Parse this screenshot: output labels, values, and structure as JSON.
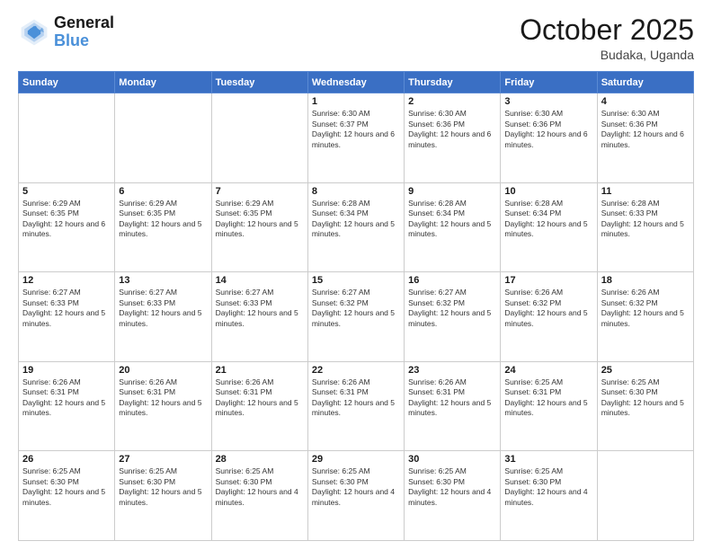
{
  "header": {
    "logo": {
      "line1": "General",
      "line2": "Blue"
    },
    "title": "October 2025",
    "subtitle": "Budaka, Uganda"
  },
  "weekdays": [
    "Sunday",
    "Monday",
    "Tuesday",
    "Wednesday",
    "Thursday",
    "Friday",
    "Saturday"
  ],
  "weeks": [
    [
      {
        "day": "",
        "info": ""
      },
      {
        "day": "",
        "info": ""
      },
      {
        "day": "",
        "info": ""
      },
      {
        "day": "1",
        "info": "Sunrise: 6:30 AM\nSunset: 6:37 PM\nDaylight: 12 hours and 6 minutes."
      },
      {
        "day": "2",
        "info": "Sunrise: 6:30 AM\nSunset: 6:36 PM\nDaylight: 12 hours and 6 minutes."
      },
      {
        "day": "3",
        "info": "Sunrise: 6:30 AM\nSunset: 6:36 PM\nDaylight: 12 hours and 6 minutes."
      },
      {
        "day": "4",
        "info": "Sunrise: 6:30 AM\nSunset: 6:36 PM\nDaylight: 12 hours and 6 minutes."
      }
    ],
    [
      {
        "day": "5",
        "info": "Sunrise: 6:29 AM\nSunset: 6:35 PM\nDaylight: 12 hours and 6 minutes."
      },
      {
        "day": "6",
        "info": "Sunrise: 6:29 AM\nSunset: 6:35 PM\nDaylight: 12 hours and 5 minutes."
      },
      {
        "day": "7",
        "info": "Sunrise: 6:29 AM\nSunset: 6:35 PM\nDaylight: 12 hours and 5 minutes."
      },
      {
        "day": "8",
        "info": "Sunrise: 6:28 AM\nSunset: 6:34 PM\nDaylight: 12 hours and 5 minutes."
      },
      {
        "day": "9",
        "info": "Sunrise: 6:28 AM\nSunset: 6:34 PM\nDaylight: 12 hours and 5 minutes."
      },
      {
        "day": "10",
        "info": "Sunrise: 6:28 AM\nSunset: 6:34 PM\nDaylight: 12 hours and 5 minutes."
      },
      {
        "day": "11",
        "info": "Sunrise: 6:28 AM\nSunset: 6:33 PM\nDaylight: 12 hours and 5 minutes."
      }
    ],
    [
      {
        "day": "12",
        "info": "Sunrise: 6:27 AM\nSunset: 6:33 PM\nDaylight: 12 hours and 5 minutes."
      },
      {
        "day": "13",
        "info": "Sunrise: 6:27 AM\nSunset: 6:33 PM\nDaylight: 12 hours and 5 minutes."
      },
      {
        "day": "14",
        "info": "Sunrise: 6:27 AM\nSunset: 6:33 PM\nDaylight: 12 hours and 5 minutes."
      },
      {
        "day": "15",
        "info": "Sunrise: 6:27 AM\nSunset: 6:32 PM\nDaylight: 12 hours and 5 minutes."
      },
      {
        "day": "16",
        "info": "Sunrise: 6:27 AM\nSunset: 6:32 PM\nDaylight: 12 hours and 5 minutes."
      },
      {
        "day": "17",
        "info": "Sunrise: 6:26 AM\nSunset: 6:32 PM\nDaylight: 12 hours and 5 minutes."
      },
      {
        "day": "18",
        "info": "Sunrise: 6:26 AM\nSunset: 6:32 PM\nDaylight: 12 hours and 5 minutes."
      }
    ],
    [
      {
        "day": "19",
        "info": "Sunrise: 6:26 AM\nSunset: 6:31 PM\nDaylight: 12 hours and 5 minutes."
      },
      {
        "day": "20",
        "info": "Sunrise: 6:26 AM\nSunset: 6:31 PM\nDaylight: 12 hours and 5 minutes."
      },
      {
        "day": "21",
        "info": "Sunrise: 6:26 AM\nSunset: 6:31 PM\nDaylight: 12 hours and 5 minutes."
      },
      {
        "day": "22",
        "info": "Sunrise: 6:26 AM\nSunset: 6:31 PM\nDaylight: 12 hours and 5 minutes."
      },
      {
        "day": "23",
        "info": "Sunrise: 6:26 AM\nSunset: 6:31 PM\nDaylight: 12 hours and 5 minutes."
      },
      {
        "day": "24",
        "info": "Sunrise: 6:25 AM\nSunset: 6:31 PM\nDaylight: 12 hours and 5 minutes."
      },
      {
        "day": "25",
        "info": "Sunrise: 6:25 AM\nSunset: 6:30 PM\nDaylight: 12 hours and 5 minutes."
      }
    ],
    [
      {
        "day": "26",
        "info": "Sunrise: 6:25 AM\nSunset: 6:30 PM\nDaylight: 12 hours and 5 minutes."
      },
      {
        "day": "27",
        "info": "Sunrise: 6:25 AM\nSunset: 6:30 PM\nDaylight: 12 hours and 5 minutes."
      },
      {
        "day": "28",
        "info": "Sunrise: 6:25 AM\nSunset: 6:30 PM\nDaylight: 12 hours and 4 minutes."
      },
      {
        "day": "29",
        "info": "Sunrise: 6:25 AM\nSunset: 6:30 PM\nDaylight: 12 hours and 4 minutes."
      },
      {
        "day": "30",
        "info": "Sunrise: 6:25 AM\nSunset: 6:30 PM\nDaylight: 12 hours and 4 minutes."
      },
      {
        "day": "31",
        "info": "Sunrise: 6:25 AM\nSunset: 6:30 PM\nDaylight: 12 hours and 4 minutes."
      },
      {
        "day": "",
        "info": ""
      }
    ]
  ]
}
